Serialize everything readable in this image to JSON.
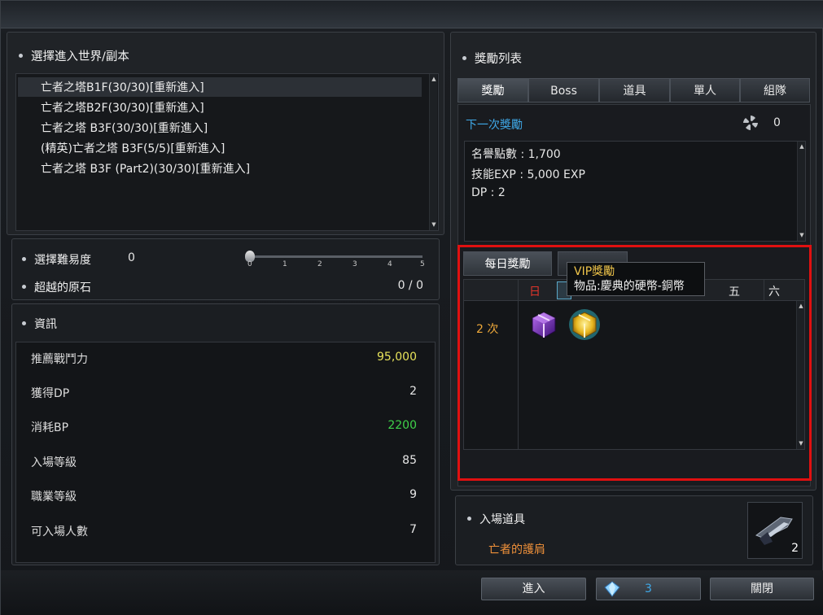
{
  "left": {
    "world_title": "選擇進入世界/副本",
    "worlds": [
      {
        "label": "亡者之塔B1F(30/30)[重新進入]"
      },
      {
        "label": "亡者之塔B2F(30/30)[重新進入]"
      },
      {
        "label": "亡者之塔 B3F(30/30)[重新進入]"
      },
      {
        "label": "(精英)亡者之塔 B3F(5/5)[重新進入]"
      },
      {
        "label": "亡者之塔 B3F (Part2)(30/30)[重新進入]"
      }
    ],
    "difficulty_label": "選擇難易度",
    "difficulty_value": "0",
    "difficulty_level": 0,
    "difficulty_ticks": [
      "0",
      "1",
      "2",
      "3",
      "4",
      "5"
    ],
    "stone_label": "超越的原石",
    "stone_value": "0 / 0",
    "info_title": "資訊",
    "info_rows": [
      {
        "label": "推薦戰鬥力",
        "value": "95,000",
        "color": "#e7e25a"
      },
      {
        "label": "獲得DP",
        "value": "2",
        "color": "#e6e6e6"
      },
      {
        "label": "消耗BP",
        "value": "2200",
        "color": "#3fd24a"
      },
      {
        "label": "入場等級",
        "value": "85",
        "color": "#e6e6e6"
      },
      {
        "label": "職業等級",
        "value": "9",
        "color": "#e6e6e6"
      },
      {
        "label": "可入場人數",
        "value": "7",
        "color": "#e6e6e6"
      }
    ]
  },
  "right": {
    "reward_title": "獎勵列表",
    "tabs": [
      "獎勵",
      "Boss",
      "道具",
      "單人",
      "組隊"
    ],
    "next_reward_label": "下一次獎勵",
    "next_reward_count": "0",
    "reward_lines": [
      "名譽點數 : 1,700",
      "技能EXP : 5,000 EXP",
      "DP : 2"
    ],
    "daily_tab": "每日獎勵",
    "second_tab": "",
    "days": [
      "日",
      "",
      "",
      "",
      "",
      "五",
      "六"
    ],
    "day_sun_color": "#e0342b",
    "times_label": "2 次",
    "tooltip_title": "VIP獎勵",
    "tooltip_item": "物品:慶典的硬幣-銅幣",
    "entry_item_title": "入場道具",
    "entry_item_name": "亡者的護肩",
    "entry_item_count": "2"
  },
  "footer": {
    "enter_label": "進入",
    "gem_count": "3",
    "close_label": "關閉"
  },
  "highlight_color": "#e01010"
}
